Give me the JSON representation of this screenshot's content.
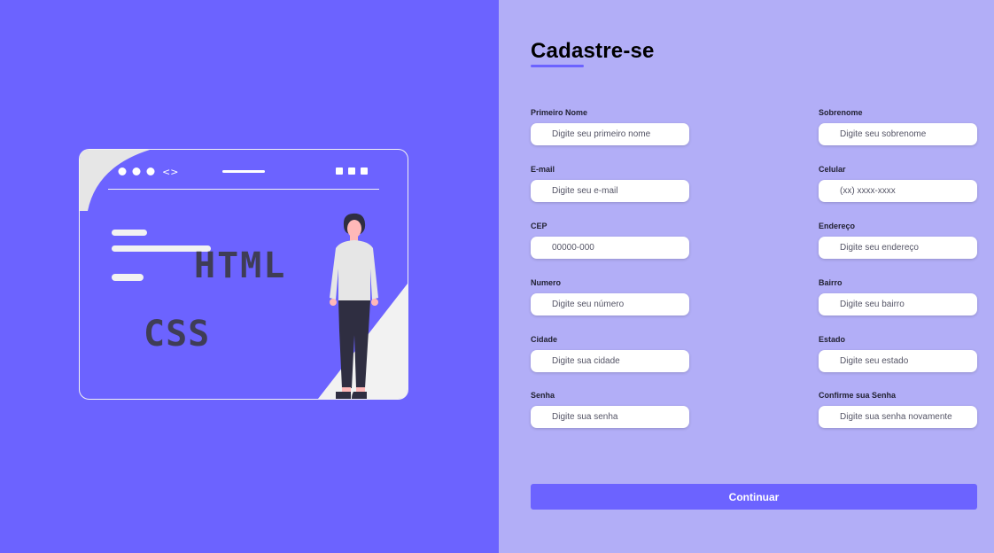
{
  "illustration": {
    "code_text_html": "HTML",
    "code_text_css": "CSS",
    "nav_arrows": "<>"
  },
  "form": {
    "title": "Cadastre-se",
    "fields": {
      "first_name": {
        "label": "Primeiro Nome",
        "placeholder": "Digite seu primeiro nome"
      },
      "last_name": {
        "label": "Sobrenome",
        "placeholder": "Digite seu sobrenome"
      },
      "email": {
        "label": "E-mail",
        "placeholder": "Digite seu e-mail"
      },
      "phone": {
        "label": "Celular",
        "placeholder": "(xx) xxxx-xxxx"
      },
      "cep": {
        "label": "CEP",
        "placeholder": "00000-000"
      },
      "address": {
        "label": "Endereço",
        "placeholder": "Digite seu endereço"
      },
      "number": {
        "label": "Numero",
        "placeholder": "Digite seu número"
      },
      "neighborhood": {
        "label": "Bairro",
        "placeholder": "Digite seu bairro"
      },
      "city": {
        "label": "Cidade",
        "placeholder": "Digite sua cidade"
      },
      "state": {
        "label": "Estado",
        "placeholder": "Digite seu estado"
      },
      "password": {
        "label": "Senha",
        "placeholder": "Digite sua senha"
      },
      "confirm_password": {
        "label": "Confirme sua Senha",
        "placeholder": "Digite sua senha novamente"
      }
    },
    "submit_label": "Continuar"
  },
  "colors": {
    "primary": "#6c63ff",
    "form_background": "#b2aef7",
    "input_background": "#ffffff",
    "illustration_light": "#f2f2f2",
    "illustration_dark": "#3f3d56"
  }
}
